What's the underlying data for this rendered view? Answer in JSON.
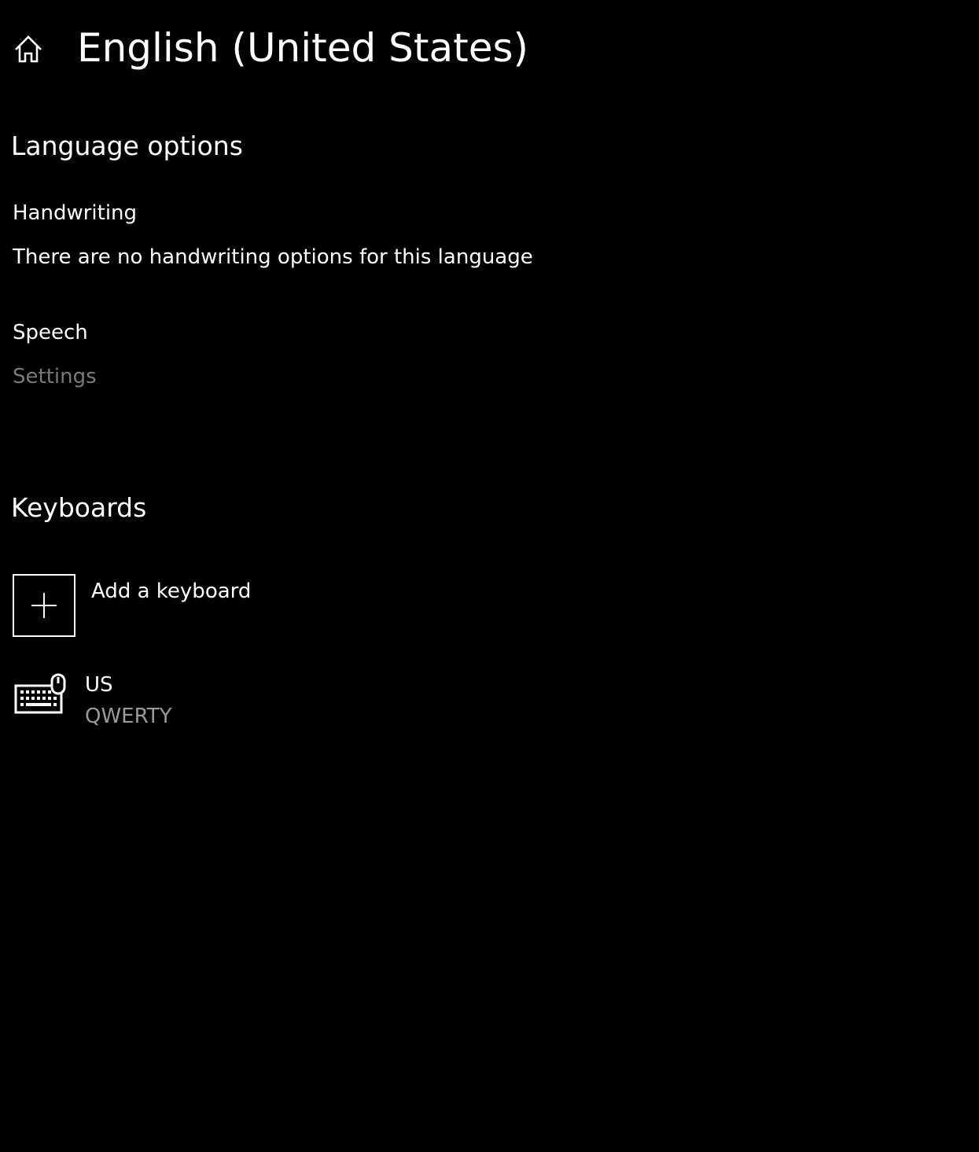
{
  "header": {
    "title": "English (United States)",
    "home_icon": "home-icon"
  },
  "language_options": {
    "heading": "Language options",
    "handwriting": {
      "label": "Handwriting",
      "description": "There are no handwriting options for this language"
    },
    "speech": {
      "label": "Speech",
      "settings_label": "Settings",
      "settings_disabled": true
    }
  },
  "keyboards": {
    "heading": "Keyboards",
    "add_label": "Add a keyboard",
    "add_icon": "plus-icon",
    "items": [
      {
        "name": "US",
        "layout": "QWERTY",
        "icon": "keyboard-icon"
      }
    ]
  },
  "colors": {
    "background": "#000000",
    "text": "#ffffff",
    "disabled_text": "#7a7a7a",
    "secondary_text": "#9a9a9a"
  }
}
